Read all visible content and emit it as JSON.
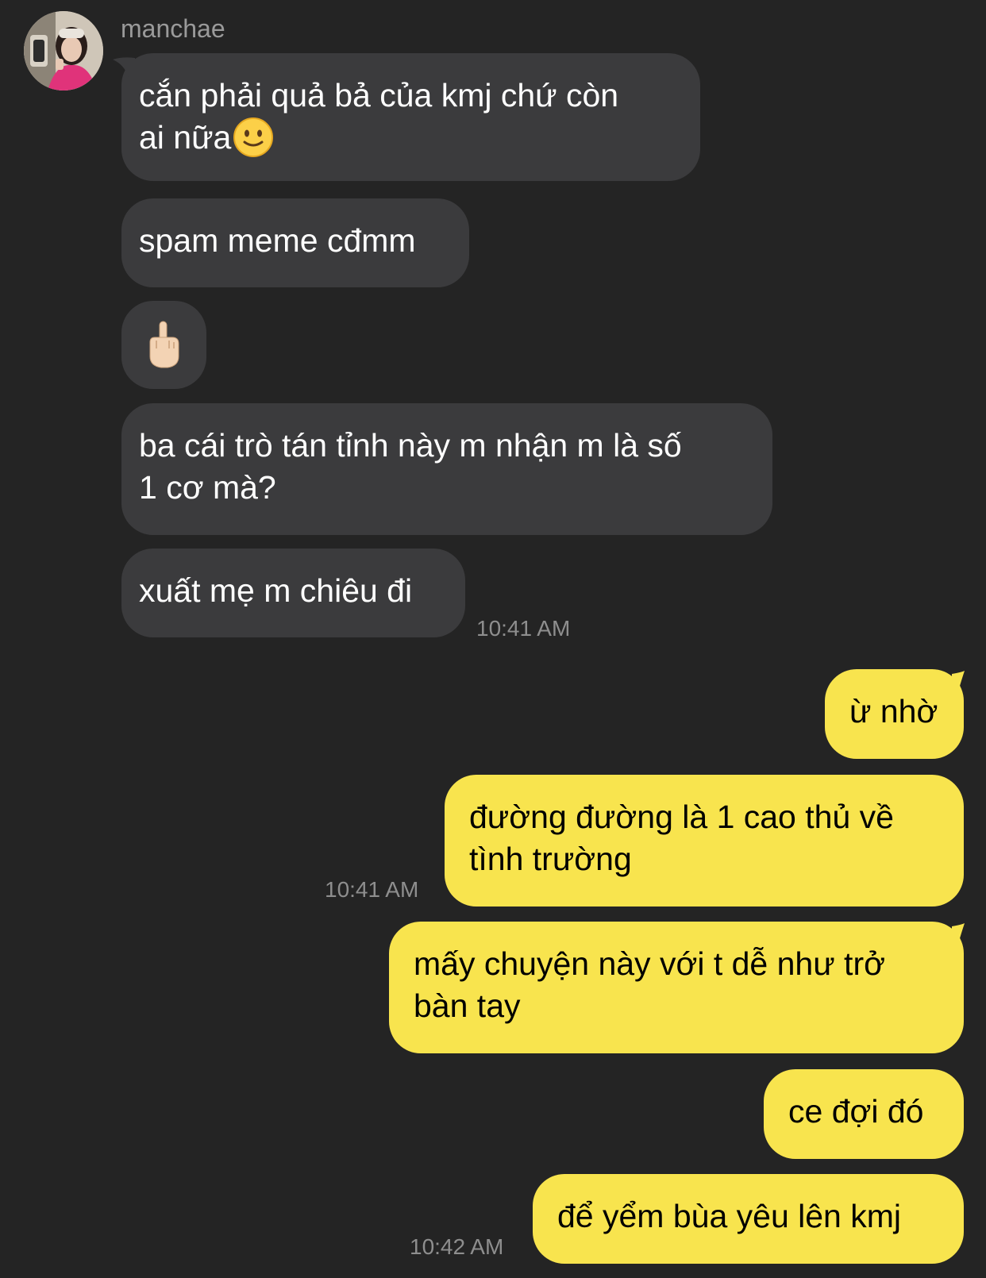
{
  "chat": {
    "sender_name": "manchae",
    "avatar_icon": "profile-photo-avatar",
    "colors": {
      "background": "#242424",
      "incoming_bubble": "#3b3b3d",
      "outgoing_bubble": "#f8e44e",
      "timestamp": "#8e8e8e"
    },
    "messages": [
      {
        "direction": "incoming",
        "line1": "cắn phải quả bả của kmj chứ còn",
        "line2": "ai nữa",
        "emoji": "slightly-smiling-face-emoji"
      },
      {
        "direction": "incoming",
        "text": "spam meme cđmm"
      },
      {
        "direction": "incoming",
        "emoji": "middle-finger-emoji"
      },
      {
        "direction": "incoming",
        "line1": "ba cái trò tán tỉnh này m nhận m là số",
        "line2": "1 cơ mà?"
      },
      {
        "direction": "incoming",
        "text": "xuất mẹ m chiêu đi",
        "time": "10:41 AM"
      },
      {
        "direction": "outgoing",
        "text": "ừ nhờ"
      },
      {
        "direction": "outgoing",
        "line1": "đường đường là 1 cao thủ về",
        "line2": "tình trường",
        "time": "10:41 AM"
      },
      {
        "direction": "outgoing",
        "line1": "mấy chuyện này với t dễ như trở",
        "line2": "bàn tay"
      },
      {
        "direction": "outgoing",
        "text": "ce đợi đó"
      },
      {
        "direction": "outgoing",
        "text": "để yểm bùa yêu lên kmj",
        "time": "10:42 AM"
      }
    ]
  }
}
